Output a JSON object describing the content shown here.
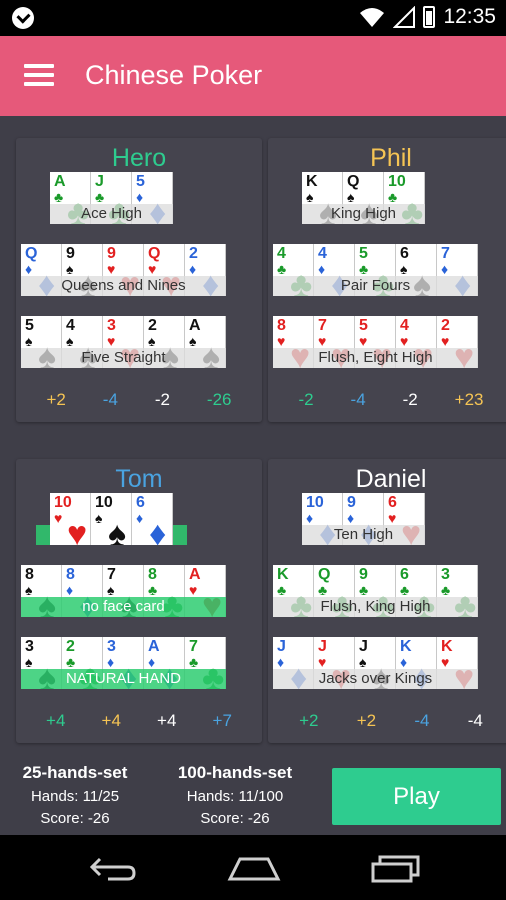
{
  "status": {
    "time": "12:35",
    "icons": [
      "app-notification-icon",
      "wifi-icon",
      "signal-icon",
      "battery-icon"
    ]
  },
  "app": {
    "title": "Chinese Poker"
  },
  "players": [
    {
      "name": "Hero",
      "name_color": "#2ecc8f",
      "rows": [
        {
          "cards": [
            {
              "r": "A",
              "s": "♣",
              "c": "grn"
            },
            {
              "r": "J",
              "s": "♣",
              "c": "grn"
            },
            {
              "r": "5",
              "s": "♦",
              "c": "blu"
            }
          ],
          "label": "Ace High"
        },
        {
          "cards": [
            {
              "r": "Q",
              "s": "♦",
              "c": "blu"
            },
            {
              "r": "9",
              "s": "♠",
              "c": "blk"
            },
            {
              "r": "9",
              "s": "♥",
              "c": "red"
            },
            {
              "r": "Q",
              "s": "♥",
              "c": "red"
            },
            {
              "r": "2",
              "s": "♦",
              "c": "blu"
            }
          ],
          "label": "Queens and Nines"
        },
        {
          "cards": [
            {
              "r": "5",
              "s": "♠",
              "c": "blk"
            },
            {
              "r": "4",
              "s": "♠",
              "c": "blk"
            },
            {
              "r": "3",
              "s": "♥",
              "c": "red"
            },
            {
              "r": "2",
              "s": "♠",
              "c": "blk"
            },
            {
              "r": "A",
              "s": "♠",
              "c": "blk"
            }
          ],
          "label": "Five Straight"
        }
      ],
      "scores": [
        {
          "v": "+2",
          "c": "#f5c454"
        },
        {
          "v": "-4",
          "c": "#4aa3e0"
        },
        {
          "v": "-2",
          "c": "#ffffff"
        },
        {
          "v": "-26",
          "c": "#2ecc8f"
        }
      ]
    },
    {
      "name": "Phil",
      "name_color": "#f5c454",
      "rows": [
        {
          "cards": [
            {
              "r": "K",
              "s": "♠",
              "c": "blk"
            },
            {
              "r": "Q",
              "s": "♠",
              "c": "blk"
            },
            {
              "r": "10",
              "s": "♣",
              "c": "grn"
            }
          ],
          "label": "King High"
        },
        {
          "cards": [
            {
              "r": "4",
              "s": "♣",
              "c": "grn"
            },
            {
              "r": "4",
              "s": "♦",
              "c": "blu"
            },
            {
              "r": "5",
              "s": "♣",
              "c": "grn"
            },
            {
              "r": "6",
              "s": "♠",
              "c": "blk"
            },
            {
              "r": "7",
              "s": "♦",
              "c": "blu"
            }
          ],
          "label": "Pair Fours"
        },
        {
          "cards": [
            {
              "r": "8",
              "s": "♥",
              "c": "red"
            },
            {
              "r": "7",
              "s": "♥",
              "c": "red"
            },
            {
              "r": "5",
              "s": "♥",
              "c": "red"
            },
            {
              "r": "4",
              "s": "♥",
              "c": "red"
            },
            {
              "r": "2",
              "s": "♥",
              "c": "red"
            }
          ],
          "label": "Flush, Eight High"
        }
      ],
      "scores": [
        {
          "v": "-2",
          "c": "#2ecc8f"
        },
        {
          "v": "-4",
          "c": "#4aa3e0"
        },
        {
          "v": "-2",
          "c": "#ffffff"
        },
        {
          "v": "+23",
          "c": "#f5c454"
        }
      ]
    },
    {
      "name": "Tom",
      "name_color": "#4aa3e0",
      "rows": [
        {
          "cards": [
            {
              "r": "10",
              "s": "♥",
              "c": "red"
            },
            {
              "r": "10",
              "s": "♠",
              "c": "blk"
            },
            {
              "r": "6",
              "s": "♦",
              "c": "blu"
            }
          ],
          "label": "",
          "green": true
        },
        {
          "cards": [
            {
              "r": "8",
              "s": "♠",
              "c": "blk"
            },
            {
              "r": "8",
              "s": "♦",
              "c": "blu"
            },
            {
              "r": "7",
              "s": "♠",
              "c": "blk"
            },
            {
              "r": "8",
              "s": "♣",
              "c": "grn"
            },
            {
              "r": "A",
              "s": "♥",
              "c": "red"
            }
          ],
          "label": "no face card",
          "green": true
        },
        {
          "cards": [
            {
              "r": "3",
              "s": "♠",
              "c": "blk"
            },
            {
              "r": "2",
              "s": "♣",
              "c": "grn"
            },
            {
              "r": "3",
              "s": "♦",
              "c": "blu"
            },
            {
              "r": "A",
              "s": "♦",
              "c": "blu"
            },
            {
              "r": "7",
              "s": "♣",
              "c": "grn"
            }
          ],
          "label": "NATURAL HAND",
          "green": true
        }
      ],
      "scores": [
        {
          "v": "+4",
          "c": "#2ecc8f"
        },
        {
          "v": "+4",
          "c": "#f5c454"
        },
        {
          "v": "+4",
          "c": "#ffffff"
        },
        {
          "v": "+7",
          "c": "#4aa3e0"
        }
      ]
    },
    {
      "name": "Daniel",
      "name_color": "#ffffff",
      "rows": [
        {
          "cards": [
            {
              "r": "10",
              "s": "♦",
              "c": "blu"
            },
            {
              "r": "9",
              "s": "♦",
              "c": "blu"
            },
            {
              "r": "6",
              "s": "♥",
              "c": "red"
            }
          ],
          "label": "Ten High"
        },
        {
          "cards": [
            {
              "r": "K",
              "s": "♣",
              "c": "grn"
            },
            {
              "r": "Q",
              "s": "♣",
              "c": "grn"
            },
            {
              "r": "9",
              "s": "♣",
              "c": "grn"
            },
            {
              "r": "6",
              "s": "♣",
              "c": "grn"
            },
            {
              "r": "3",
              "s": "♣",
              "c": "grn"
            }
          ],
          "label": "Flush, King High"
        },
        {
          "cards": [
            {
              "r": "J",
              "s": "♦",
              "c": "blu"
            },
            {
              "r": "J",
              "s": "♥",
              "c": "red"
            },
            {
              "r": "J",
              "s": "♠",
              "c": "blk"
            },
            {
              "r": "K",
              "s": "♦",
              "c": "blu"
            },
            {
              "r": "K",
              "s": "♥",
              "c": "red"
            }
          ],
          "label": "Jacks over Kings"
        }
      ],
      "scores": [
        {
          "v": "+2",
          "c": "#2ecc8f"
        },
        {
          "v": "+2",
          "c": "#f5c454"
        },
        {
          "v": "-4",
          "c": "#4aa3e0"
        },
        {
          "v": "-4",
          "c": "#ffffff"
        }
      ]
    }
  ],
  "sets": [
    {
      "title": "25-hands-set",
      "hands": "Hands: 11/25",
      "score": "Score: -26"
    },
    {
      "title": "100-hands-set",
      "hands": "Hands: 11/100",
      "score": "Score: -26"
    }
  ],
  "play_label": "Play",
  "navbar": {
    "icons": [
      "back-icon",
      "home-icon",
      "recents-icon"
    ]
  }
}
